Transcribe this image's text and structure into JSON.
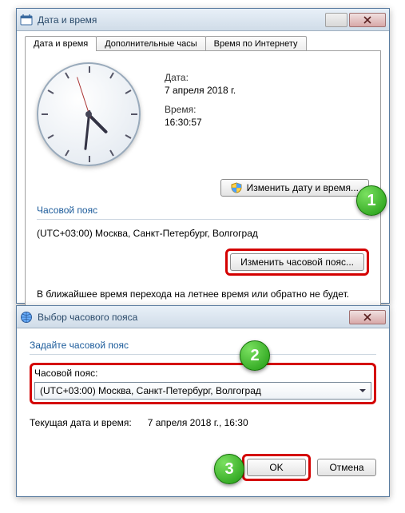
{
  "w1": {
    "title": "Дата и время",
    "tabs": [
      "Дата и время",
      "Дополнительные часы",
      "Время по Интернету"
    ],
    "date_label": "Дата:",
    "date_value": "7 апреля 2018 г.",
    "time_label": "Время:",
    "time_value": "16:30:57",
    "change_dt_btn": "Изменить дату и время...",
    "tz_section": "Часовой пояс",
    "tz_value": "(UTC+03:00) Москва, Санкт-Петербург, Волгоград",
    "change_tz_btn": "Изменить часовой пояс...",
    "dst_note": "В ближайшее время перехода на летнее время или обратно не будет."
  },
  "w2": {
    "title": "Выбор часового пояса",
    "prompt": "Задайте часовой пояс",
    "field_label": "Часовой пояс:",
    "combo_value": "(UTC+03:00) Москва, Санкт-Петербург, Волгоград",
    "cur_label": "Текущая дата и время:",
    "cur_value": "7 апреля 2018 г., 16:30",
    "ok": "OK",
    "cancel": "Отмена"
  },
  "markers": {
    "m1": "1",
    "m2": "2",
    "m3": "3"
  },
  "icons": {
    "calendar": "calendar-icon",
    "globe": "globe-icon",
    "shield": "shield-icon",
    "close": "close-icon"
  }
}
